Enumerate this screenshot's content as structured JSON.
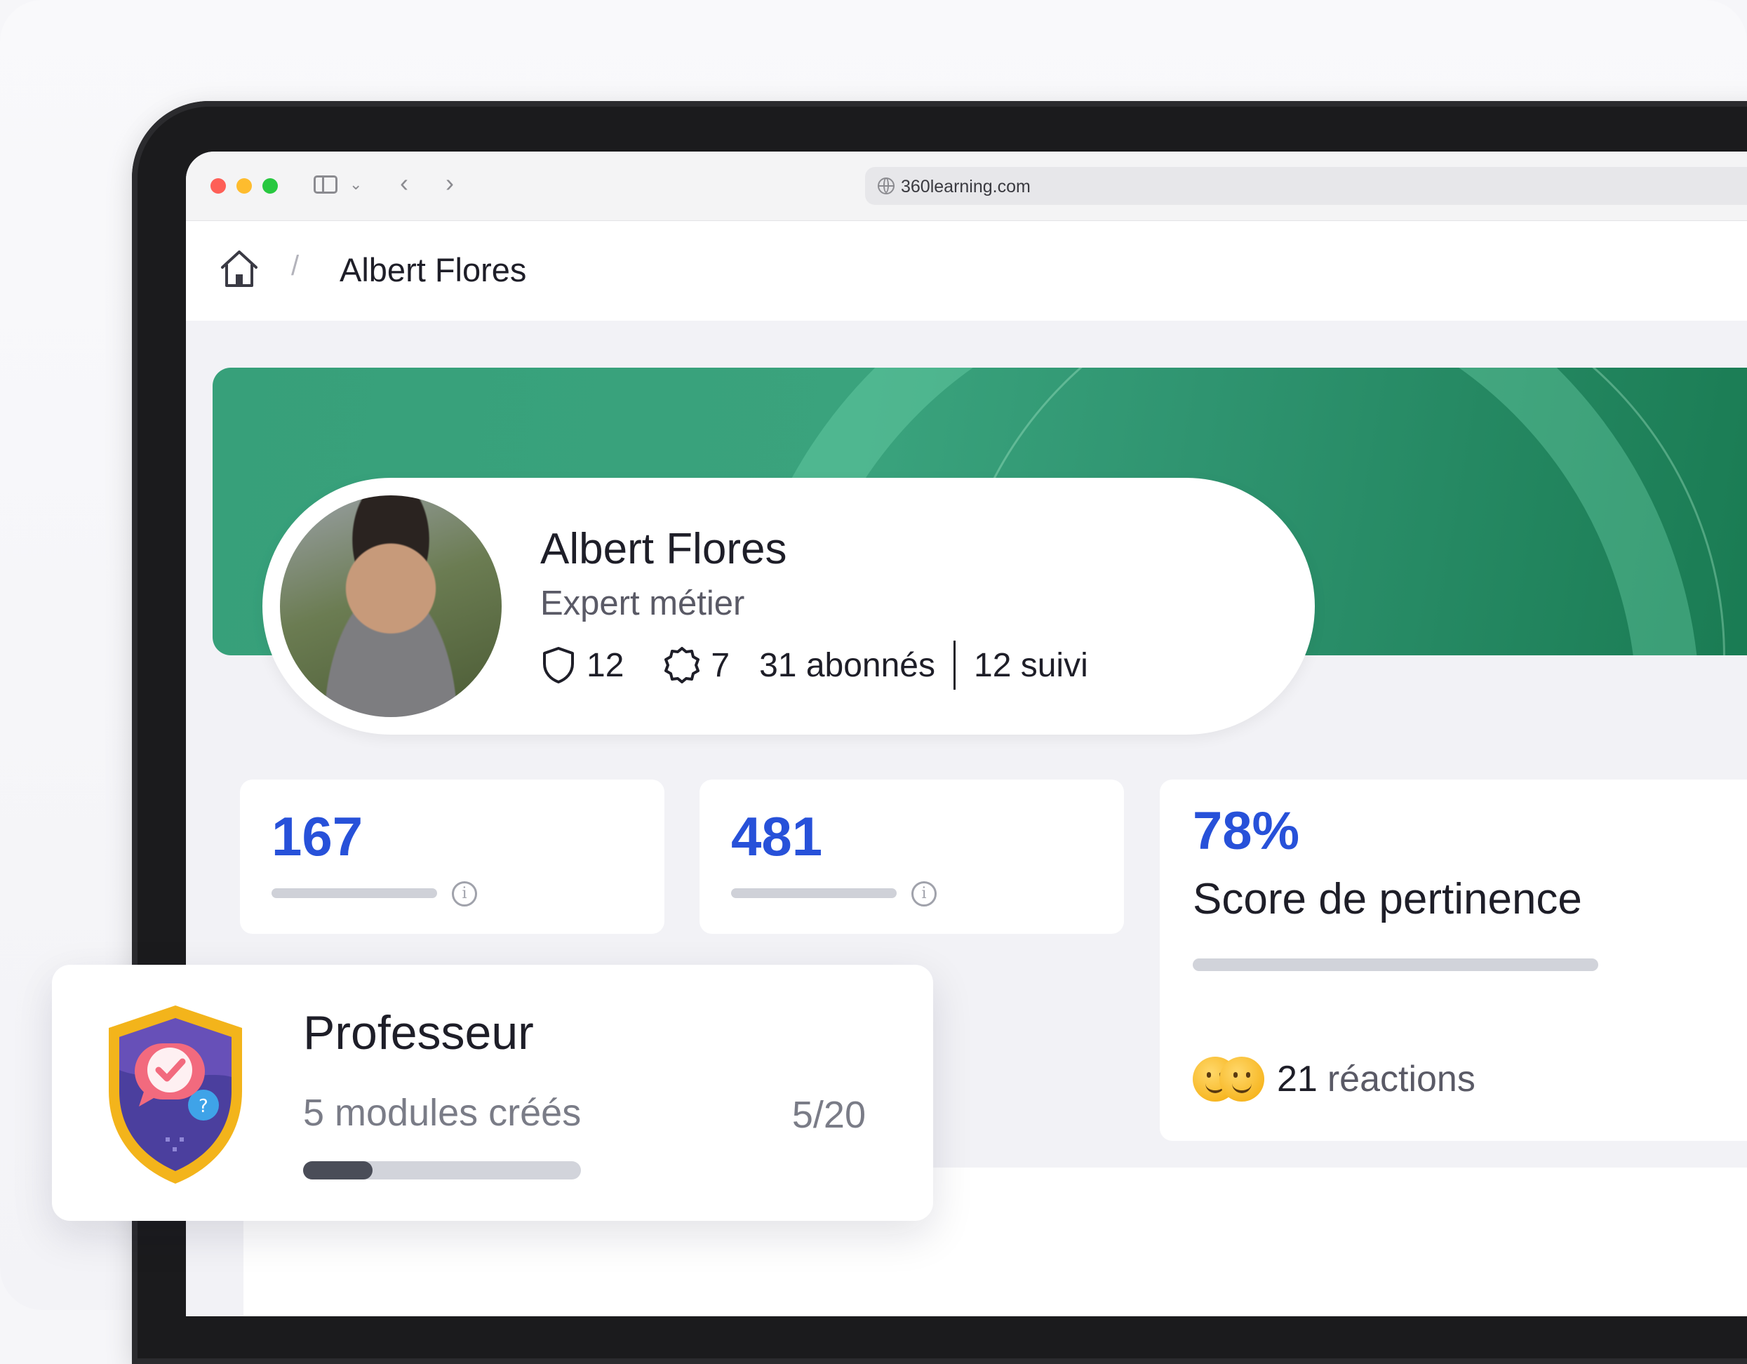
{
  "browser": {
    "url": "360learning.com"
  },
  "breadcrumb": {
    "current": "Albert Flores",
    "separator": "/"
  },
  "profile": {
    "name": "Albert Flores",
    "role": "Expert métier",
    "badges_count": "12",
    "certifications_count": "7",
    "followers": "31 abonnés",
    "following": "12 suivi"
  },
  "stats": {
    "card1_value": "167",
    "card2_value": "481",
    "info_glyph": "i",
    "score_value": "78%",
    "score_label": "Score de pertinence",
    "reactions_count": "21",
    "reactions_label": "réactions"
  },
  "badge": {
    "title": "Professeur",
    "subtitle": "5 modules créés",
    "progress_text": "5/20",
    "progress_fraction": 0.25
  },
  "colors": {
    "accent_blue": "#2751d9",
    "banner_green": "#37a07a",
    "badge_gold": "#f3b41b",
    "badge_purple": "#4b3f9e"
  },
  "icons": [
    "home-icon",
    "shield-icon",
    "certificate-icon",
    "info-icon",
    "globe-icon",
    "sidebar-toggle-icon",
    "chevron-down-icon",
    "back-icon",
    "forward-icon"
  ]
}
